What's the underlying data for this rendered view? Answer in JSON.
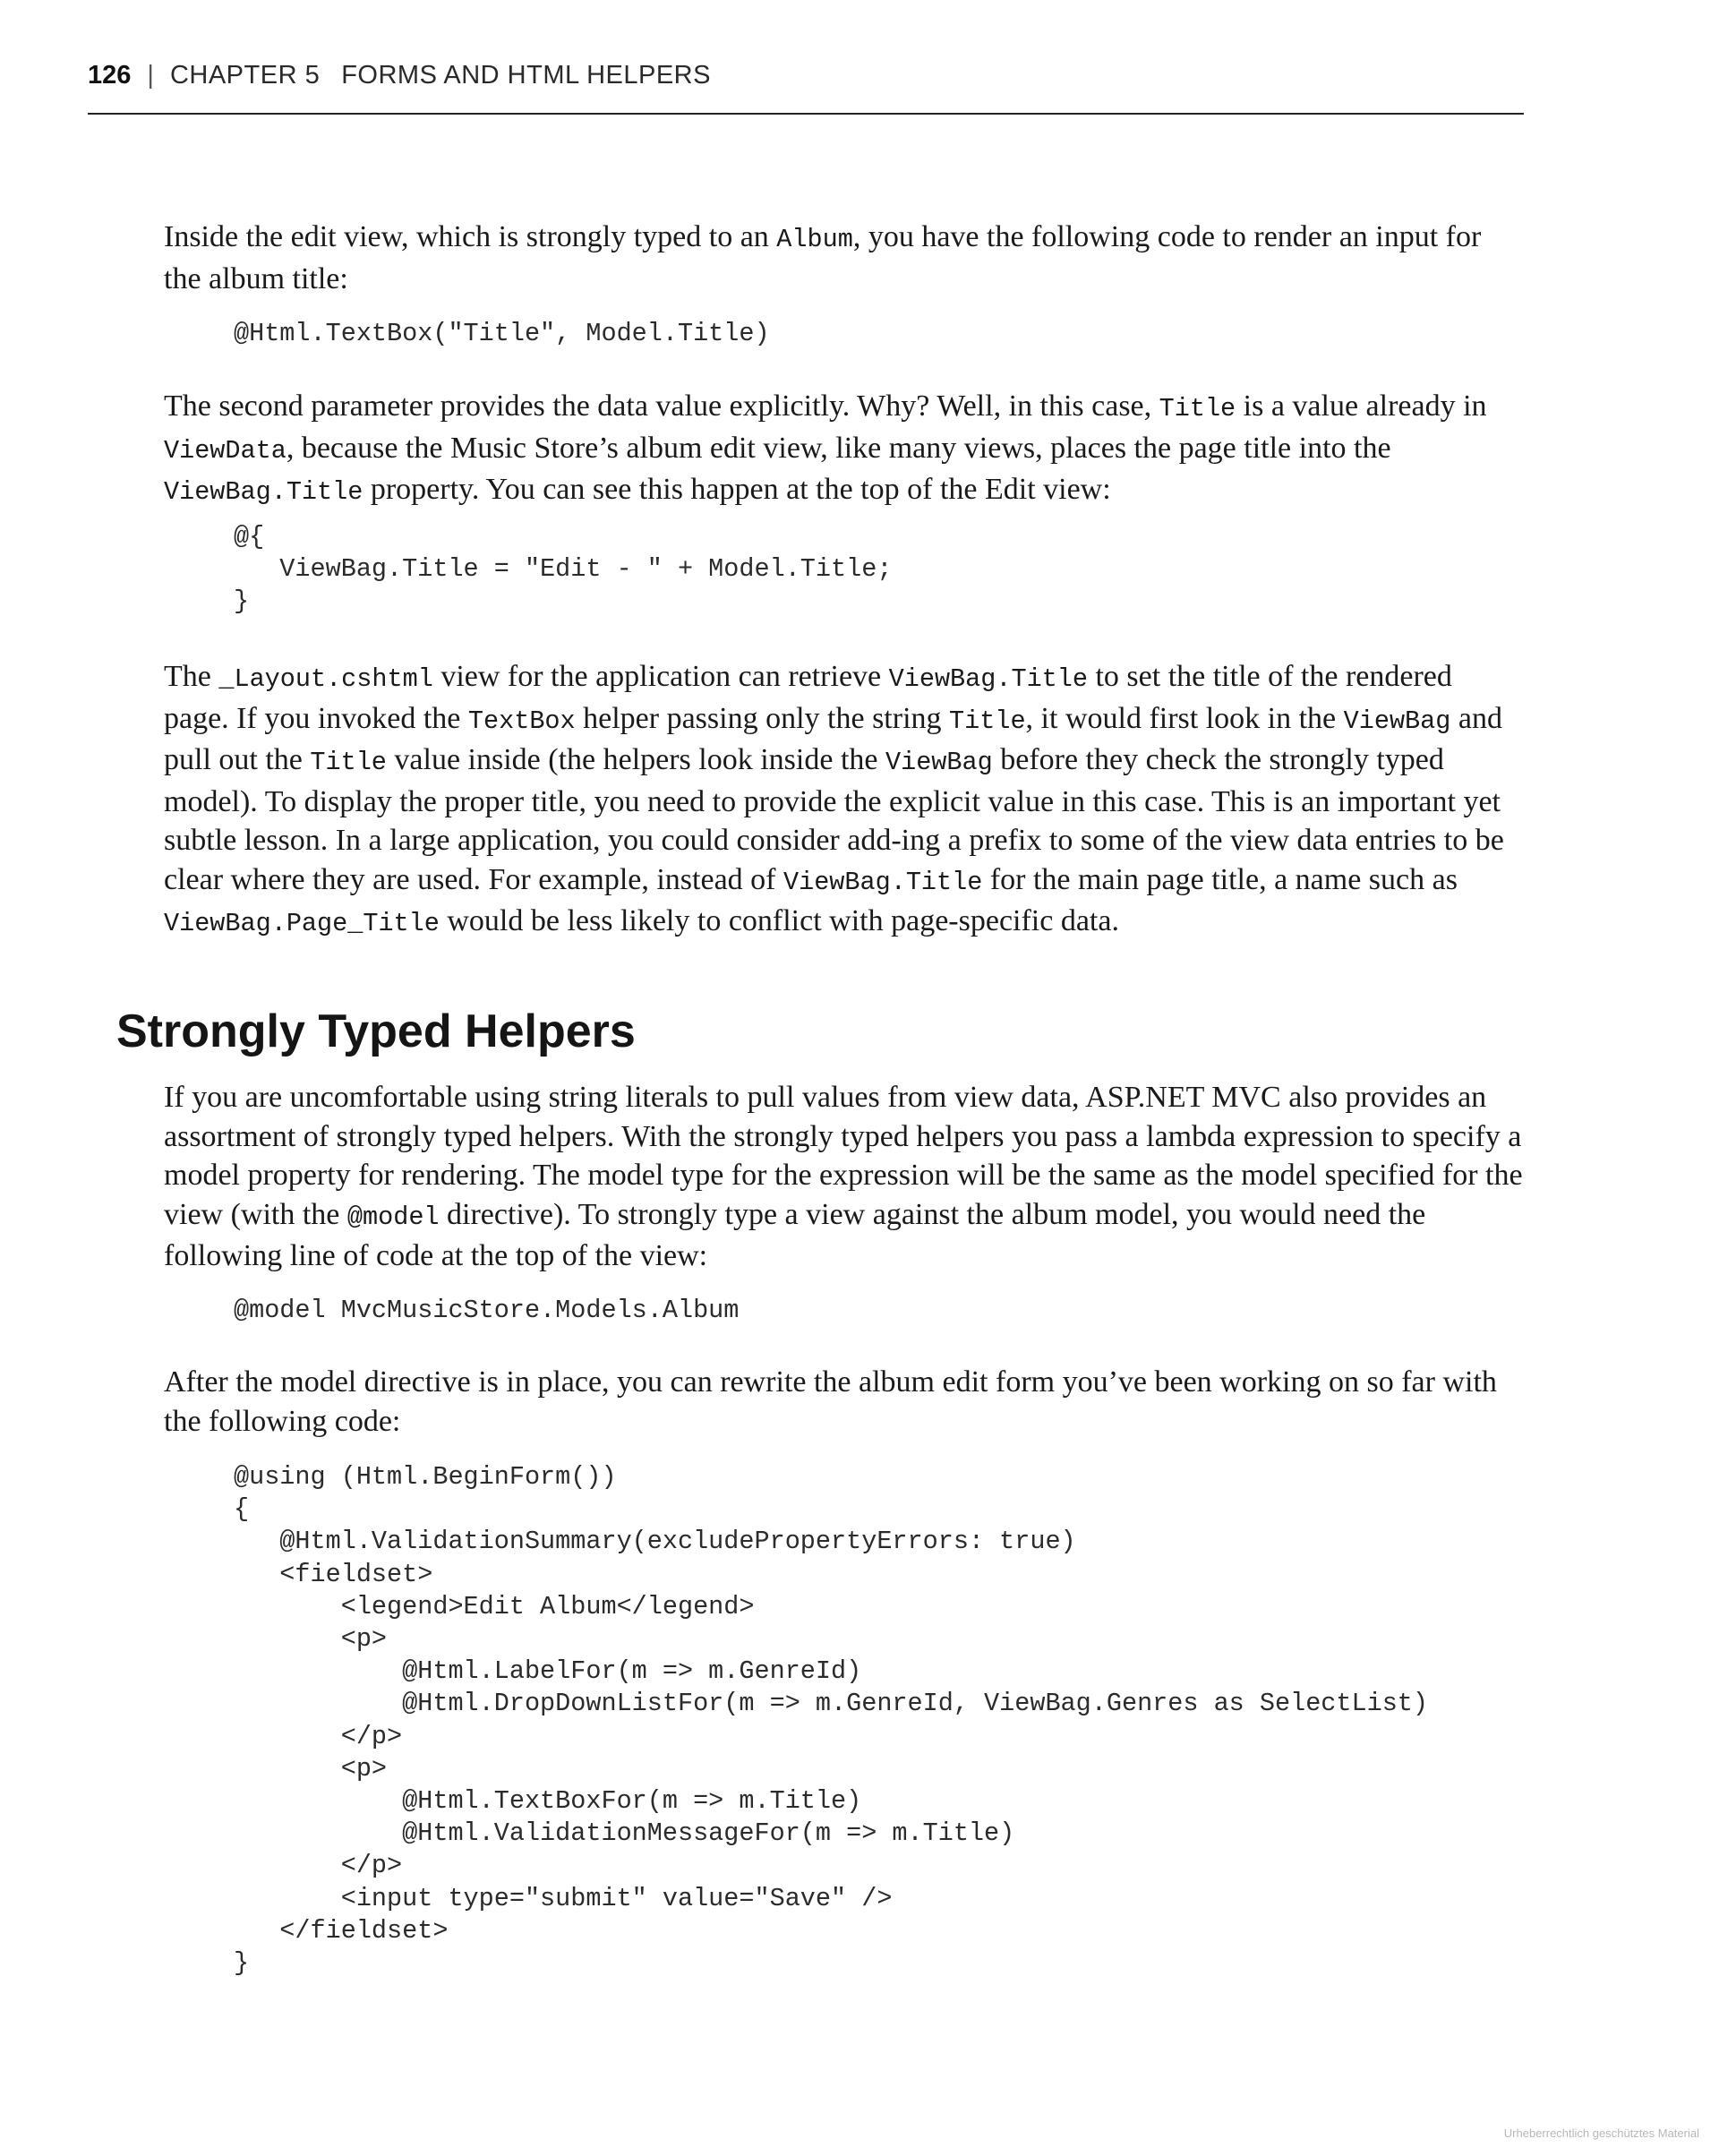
{
  "header": {
    "page_number": "126",
    "separator": "|",
    "chapter_label": "CHAPTER 5",
    "chapter_title": "FORMS AND HTML HELPERS"
  },
  "p1": {
    "t1": "Inside the edit view, which is strongly typed to an ",
    "c1": "Album",
    "t2": ", you have the following code to render an input for the album title:"
  },
  "code1": "@Html.TextBox(\"Title\", Model.Title)",
  "p2": {
    "t1": "The second parameter provides the data value explicitly. Why? Well, in this case, ",
    "c1": "Title",
    "t2": " is a value already in ",
    "c2": "ViewData",
    "t3": ", because the Music Store’s album edit view, like many views, places the page title into the ",
    "c3": "ViewBag.Title",
    "t4": " property. You can see this happen at the top of the Edit view:"
  },
  "code2": "@{\n   ViewBag.Title = \"Edit - \" + Model.Title;\n}",
  "p3": {
    "t1": "The ",
    "c1": "_Layout.cshtml",
    "t2": " view for the application can retrieve ",
    "c2": "ViewBag.Title",
    "t3": " to set the title of the rendered page. If you invoked the ",
    "c3": "TextBox",
    "t4": " helper passing only the string ",
    "c4": "Title",
    "t5": ", it would first look in the ",
    "c5": "ViewBag",
    "t6": " and pull out the ",
    "c6": "Title",
    "t7": " value inside (the helpers look inside the ",
    "c7": "ViewBag",
    "t8": " before they check the strongly typed model). To display the proper title, you need to provide the explicit value in this case. This is an important yet subtle lesson. In a large application, you could consider add-ing a prefix to some of the view data entries to be clear where they are used. For example, instead of ",
    "c8": "ViewBag.Title",
    "t9": " for the main page title, a name such as ",
    "c9": "ViewBag.Page_Title",
    "t10": " would be less likely to conflict with page-specific data."
  },
  "section_heading": "Strongly Typed Helpers",
  "p4": {
    "t1": "If you are uncomfortable using string literals to pull values from view data, ASP.NET MVC also provides an assortment of strongly typed helpers. With the strongly typed helpers you pass a lambda expression to specify a model property for rendering. The model type for the expression will be the same as the model specified for the view (with the ",
    "c1": "@model",
    "t2": " directive). To strongly type a view against the album model, you would need the following line of code at the top of the view:"
  },
  "code3": "@model MvcMusicStore.Models.Album",
  "p5": {
    "t1": "After the model directive is in place, you can rewrite the album edit form you’ve been working on so far with the following code:"
  },
  "code4": "@using (Html.BeginForm())\n{\n   @Html.ValidationSummary(excludePropertyErrors: true)\n   <fieldset>\n       <legend>Edit Album</legend>\n       <p>\n           @Html.LabelFor(m => m.GenreId)\n           @Html.DropDownListFor(m => m.GenreId, ViewBag.Genres as SelectList)\n       </p>\n       <p>\n           @Html.TextBoxFor(m => m.Title)\n           @Html.ValidationMessageFor(m => m.Title)\n       </p>\n       <input type=\"submit\" value=\"Save\" />\n   </fieldset>\n}",
  "watermark": "Urheberrechtlich geschütztes Material"
}
